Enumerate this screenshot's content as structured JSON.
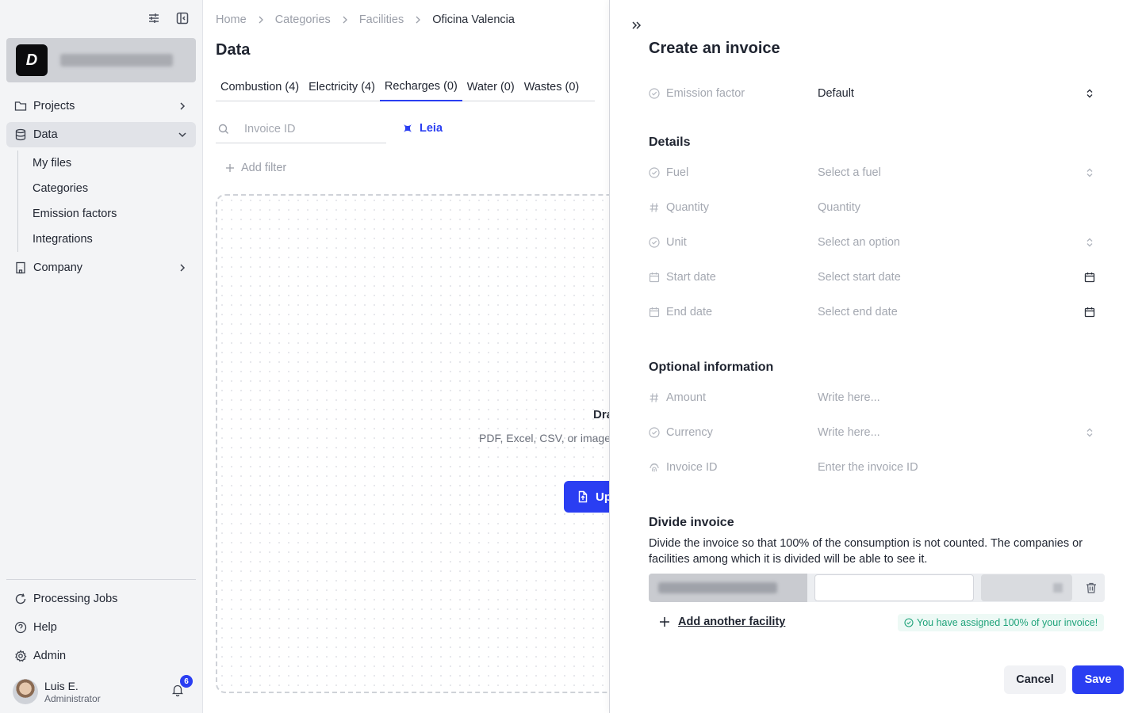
{
  "sidebar": {
    "nav": {
      "projects": "Projects",
      "data": "Data",
      "data_children": [
        "My files",
        "Categories",
        "Emission factors",
        "Integrations"
      ],
      "company": "Company"
    },
    "bottom": {
      "processing_jobs": "Processing Jobs",
      "help": "Help",
      "admin": "Admin"
    },
    "user": {
      "name": "Luis E.",
      "role": "Administrator",
      "notifications": "6"
    }
  },
  "main": {
    "breadcrumb": [
      "Home",
      "Categories",
      "Facilities",
      "Oficina Valencia"
    ],
    "title": "Data",
    "tabs": [
      "Combustion (4)",
      "Electricity (4)",
      "Recharges (0)",
      "Water (0)",
      "Wastes (0)"
    ],
    "active_tab": "Recharges (0)",
    "search_placeholder": "Invoice ID",
    "leia_label": "Leia",
    "add_filter": "Add filter",
    "dropzone": {
      "title": "Dra",
      "subtitle": "PDF, Excel, CSV, or image",
      "upload_label": "Up"
    }
  },
  "panel": {
    "title": "Create an invoice",
    "emission_factor": {
      "label": "Emission factor",
      "value": "Default"
    },
    "details_title": "Details",
    "fields": {
      "fuel": {
        "label": "Fuel",
        "placeholder": "Select a fuel"
      },
      "quantity": {
        "label": "Quantity",
        "placeholder": "Quantity"
      },
      "unit": {
        "label": "Unit",
        "placeholder": "Select an option"
      },
      "start_date": {
        "label": "Start date",
        "placeholder": "Select start date"
      },
      "end_date": {
        "label": "End date",
        "placeholder": "Select end date"
      }
    },
    "optional_title": "Optional information",
    "optional": {
      "amount": {
        "label": "Amount",
        "placeholder": "Write here..."
      },
      "currency": {
        "label": "Currency",
        "placeholder": "Write here..."
      },
      "invoice_id": {
        "label": "Invoice ID",
        "placeholder": "Enter the invoice ID"
      }
    },
    "divide": {
      "title": "Divide invoice",
      "description": "Divide the invoice so that 100% of the consumption is not counted. The companies or facilities among which it is divided will be able to see it.",
      "add_facility": "Add another facility",
      "assigned_message": "You have assigned 100% of your invoice!"
    },
    "buttons": {
      "cancel": "Cancel",
      "save": "Save"
    }
  },
  "colors": {
    "accent": "#2a3ef2",
    "success": "#1fa37a",
    "sidebar_bg": "#f3f4f6"
  }
}
